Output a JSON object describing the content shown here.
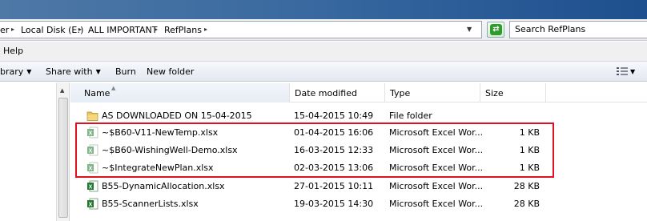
{
  "address": {
    "crumbs": [
      "er",
      "Local Disk (E:)",
      "ALL IMPORTANT",
      "RefPlans"
    ],
    "search_placeholder": "Search RefPlans"
  },
  "menu": {
    "help": "Help"
  },
  "toolbar": {
    "library": "brary",
    "share_with": "Share with",
    "burn": "Burn",
    "new_folder": "New folder"
  },
  "columns": {
    "name": "Name",
    "date": "Date modified",
    "type": "Type",
    "size": "Size"
  },
  "files": [
    {
      "name": "AS DOWNLOADED ON 15-04-2015",
      "date": "15-04-2015 10:49",
      "type": "File folder",
      "size": "",
      "icon": "folder-icon"
    },
    {
      "name": "~$B60-V11-NewTemp.xlsx",
      "date": "01-04-2015 16:06",
      "type": "Microsoft Excel Wor...",
      "size": "1 KB",
      "icon": "excel-file-icon",
      "hidden": true
    },
    {
      "name": "~$B60-WishingWell-Demo.xlsx",
      "date": "16-03-2015 12:33",
      "type": "Microsoft Excel Wor...",
      "size": "1 KB",
      "icon": "excel-file-icon",
      "hidden": true
    },
    {
      "name": "~$IntegrateNewPlan.xlsx",
      "date": "02-03-2015 13:06",
      "type": "Microsoft Excel Wor...",
      "size": "1 KB",
      "icon": "excel-file-icon",
      "hidden": true
    },
    {
      "name": "B55-DynamicAllocation.xlsx",
      "date": "27-01-2015 10:11",
      "type": "Microsoft Excel Wor...",
      "size": "28 KB",
      "icon": "excel-file-icon"
    },
    {
      "name": "B55-ScannerLists.xlsx",
      "date": "19-03-2015 14:30",
      "type": "Microsoft Excel Wor...",
      "size": "28 KB",
      "icon": "excel-file-icon"
    }
  ],
  "colors": {
    "highlight": "#e01020",
    "excel_green": "#1e7a2e",
    "folder_yellow": "#e8c25a"
  }
}
